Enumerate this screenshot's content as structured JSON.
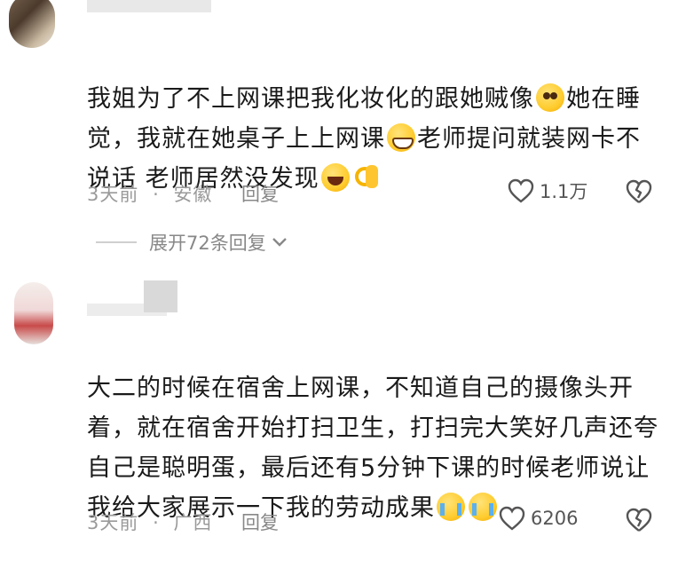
{
  "comments": [
    {
      "text_parts": [
        "我姐为了不上网课把我化妆化的跟她贼像",
        "她在睡觉，我就在她桌子上上网课",
        "老师提问就装网卡不说话 老师居然没发现",
        ""
      ],
      "emojis": [
        "blush-emoji",
        "grin-sweat-emoji",
        "laugh-cry-emoji",
        "ok-hand-emoji"
      ],
      "time": "3天前",
      "region": "安徽",
      "reply_label": "回复",
      "likes": "1.1万",
      "expand_label": "展开72条回复"
    },
    {
      "text_parts": [
        "大二的时候在宿舍上网课，不知道自己的摄像头开着，就在宿舍开始打扫卫生，打扫完大笑好几声还夸自己是聪明蛋，最后还有5分钟下课的时候老师说让我给大家展示一下我的劳动成果"
      ],
      "emojis": [
        "crying-emoji",
        "crying-emoji"
      ],
      "time": "3天前",
      "region": "广西",
      "reply_label": "回复",
      "likes": "6206"
    }
  ],
  "separator": "·"
}
